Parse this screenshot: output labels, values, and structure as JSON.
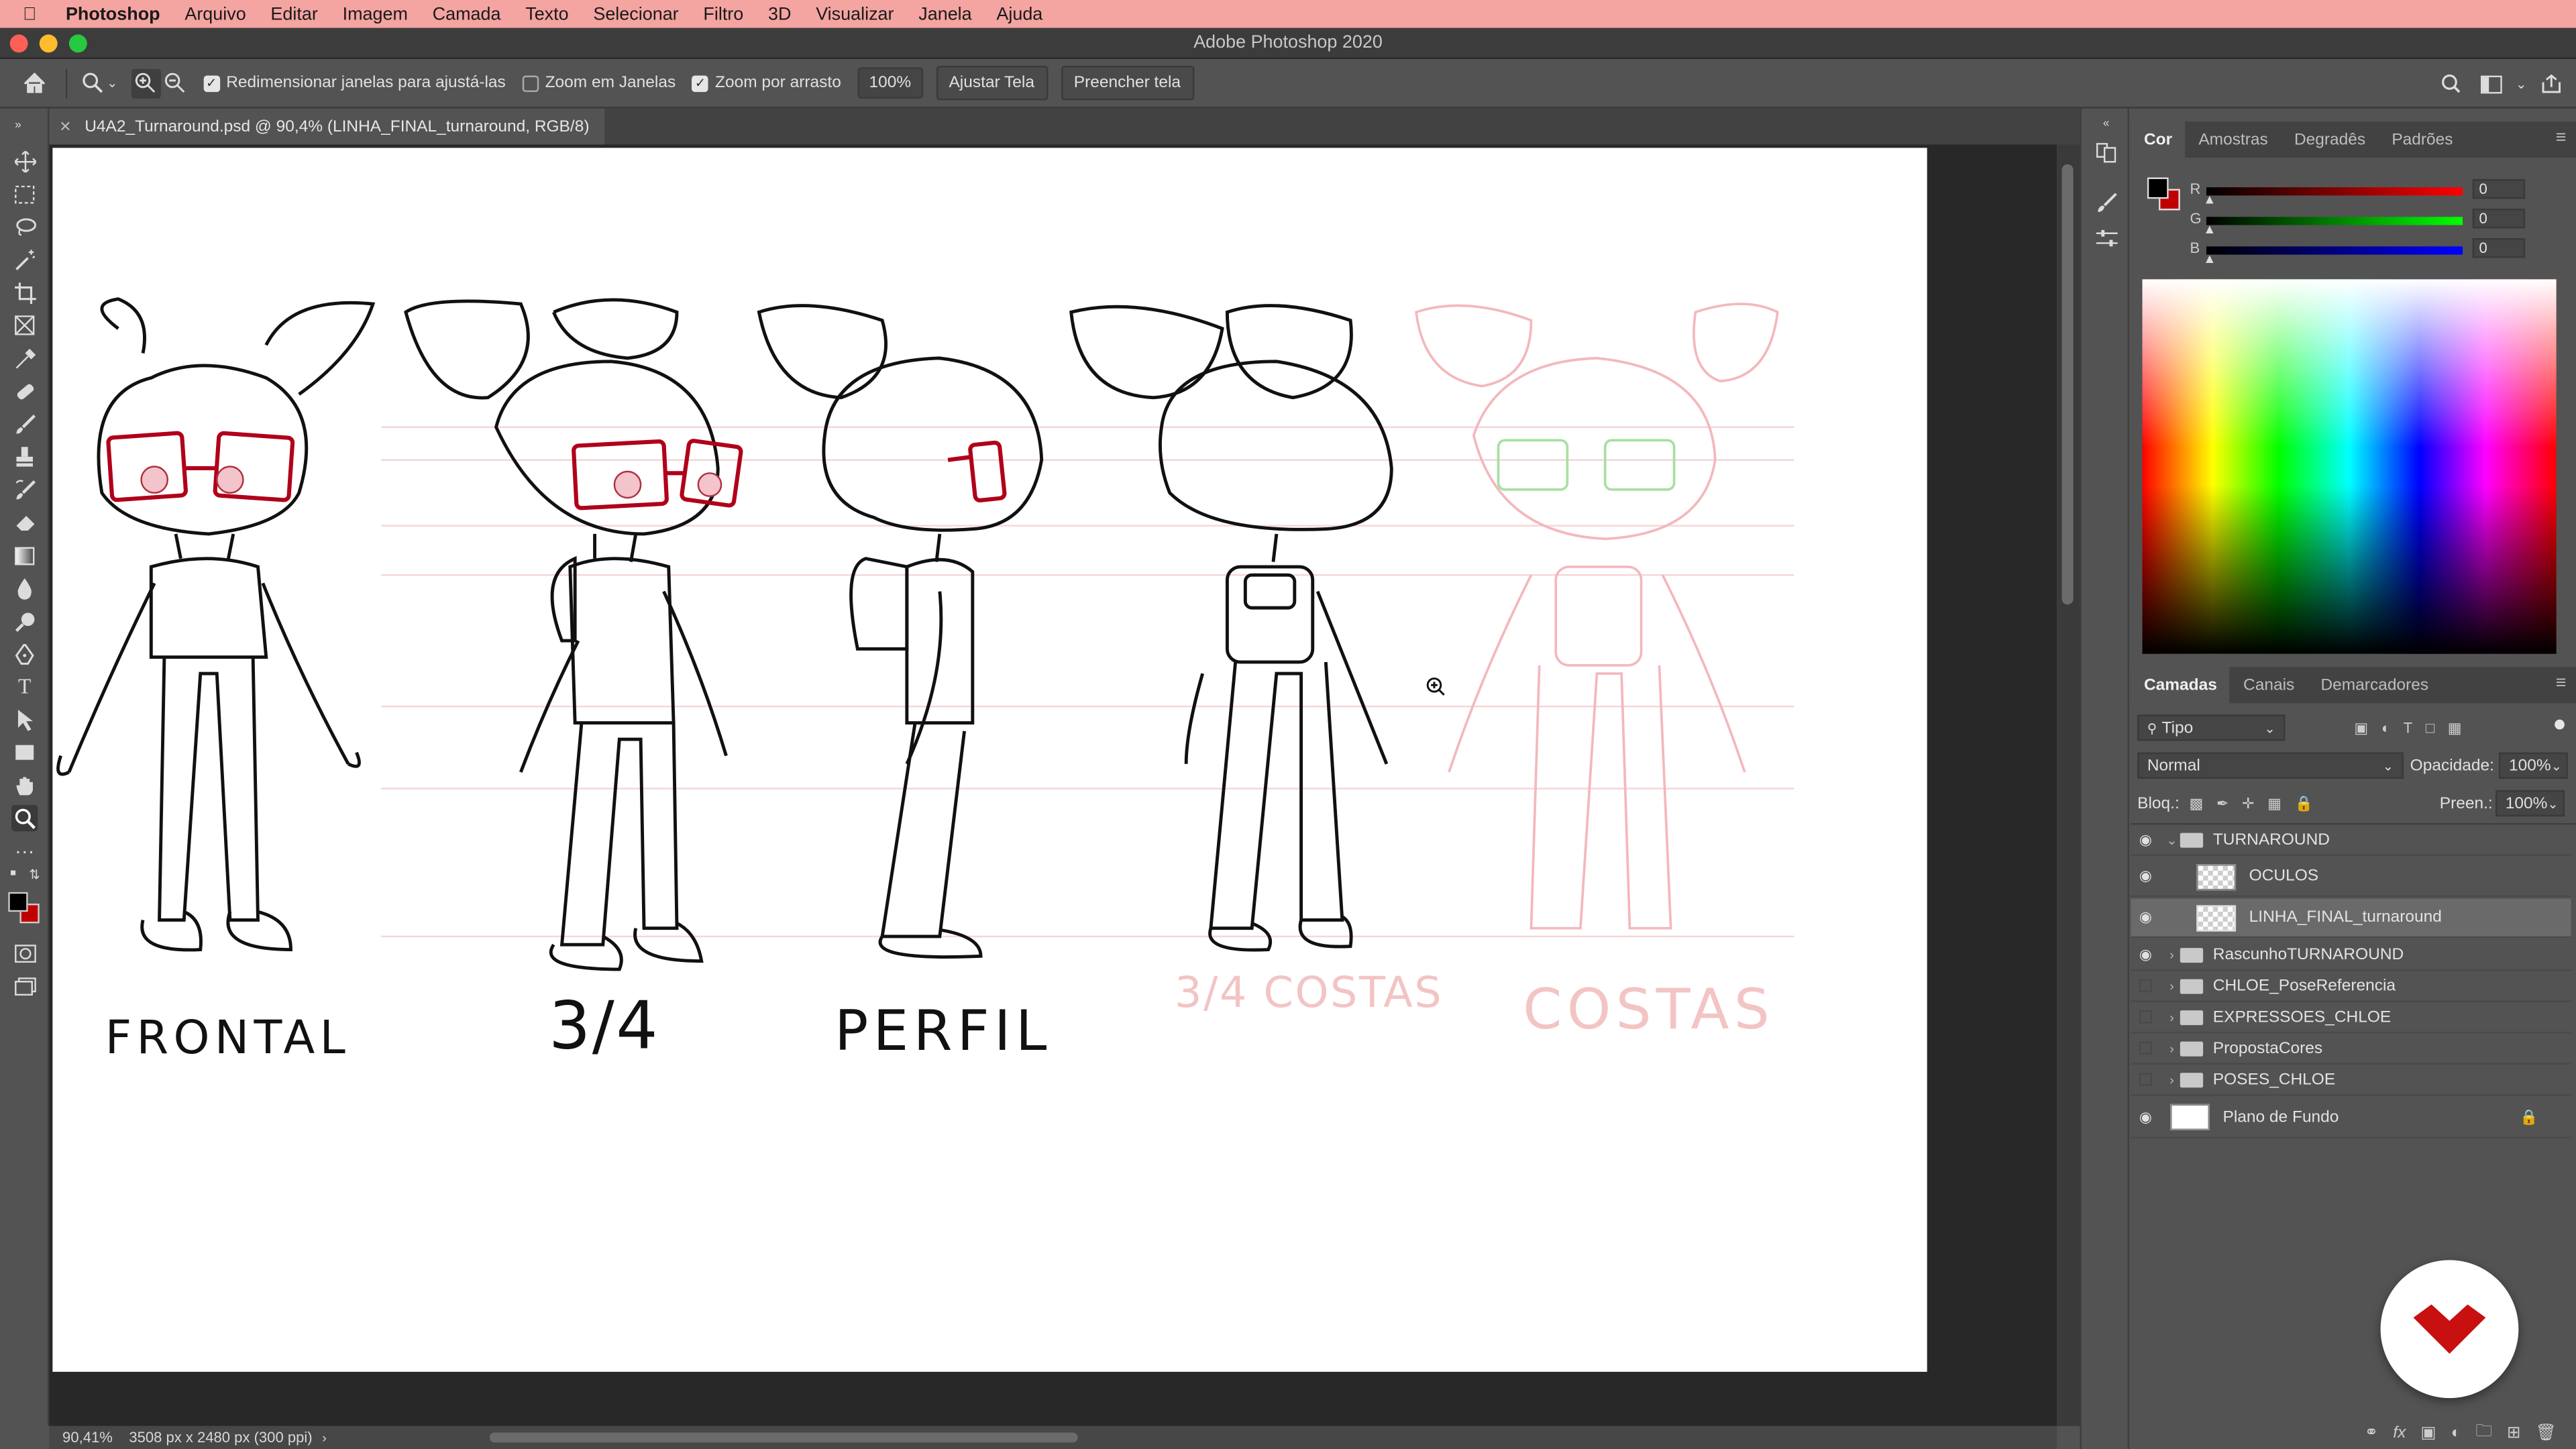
{
  "menubar": {
    "app": "Photoshop",
    "items": [
      "Arquivo",
      "Editar",
      "Imagem",
      "Camada",
      "Texto",
      "Selecionar",
      "Filtro",
      "3D",
      "Visualizar",
      "Janela",
      "Ajuda"
    ]
  },
  "window": {
    "title": "Adobe Photoshop 2020"
  },
  "options": {
    "resize_windows": "Redimensionar janelas para ajustá-las",
    "zoom_all_windows": "Zoom em Janelas",
    "scrubby_zoom": "Zoom por arrasto",
    "zoom_value": "100%",
    "fit_screen": "Ajustar Tela",
    "fill_screen": "Preencher tela",
    "resize_checked": true,
    "zoom_all_checked": false,
    "scrubby_checked": true
  },
  "document": {
    "tab_title": "U4A2_Turnaround.psd @ 90,4% (LINHA_FINAL_turnaround, RGB/8)",
    "labels": {
      "frontal": "FRONTAL",
      "three_quarter": "3/4",
      "profile": "PERFIL",
      "back_three_quarter": "3/4 COSTAS",
      "back": "COSTAS"
    }
  },
  "status": {
    "zoom": "90,41%",
    "info": "3508 px x 2480 px (300 ppi)"
  },
  "color_panel": {
    "tabs": [
      "Cor",
      "Amostras",
      "Degradês",
      "Padrões"
    ],
    "active_tab": "Cor",
    "r_label": "R",
    "g_label": "G",
    "b_label": "B",
    "r": "0",
    "g": "0",
    "b": "0",
    "foreground": "#000000",
    "background": "#c00000"
  },
  "layers_panel": {
    "tabs": [
      "Camadas",
      "Canais",
      "Demarcadores"
    ],
    "active_tab": "Camadas",
    "filter_kind": "Tipo",
    "blend_mode": "Normal",
    "opacity_label": "Opacidade:",
    "opacity": "100%",
    "lock_label": "Bloq.:",
    "fill_label": "Preen.:",
    "fill": "100%",
    "layers": [
      {
        "name": "TURNAROUND",
        "type": "group",
        "visible": true,
        "expanded": true,
        "indent": 0
      },
      {
        "name": "OCULOS",
        "type": "layer",
        "visible": true,
        "indent": 1
      },
      {
        "name": "LINHA_FINAL_turnaround",
        "type": "layer",
        "visible": true,
        "indent": 1,
        "selected": true
      },
      {
        "name": "RascunhoTURNAROUND",
        "type": "group",
        "visible": true,
        "indent": 0
      },
      {
        "name": "CHLOE_PoseReferencia",
        "type": "group",
        "visible": false,
        "indent": 0
      },
      {
        "name": "EXPRESSOES_CHLOE",
        "type": "group",
        "visible": false,
        "indent": 0
      },
      {
        "name": "PropostaCores",
        "type": "group",
        "visible": false,
        "indent": 0
      },
      {
        "name": "POSES_CHLOE",
        "type": "group",
        "visible": false,
        "indent": 0
      },
      {
        "name": "Plano de Fundo",
        "type": "background",
        "visible": true,
        "locked": true,
        "indent": 0
      }
    ]
  },
  "colors": {
    "menubar": "#f4a4a1",
    "ui_bg": "#535353",
    "accent_red": "#c00000",
    "badge_red": "#c81010"
  }
}
